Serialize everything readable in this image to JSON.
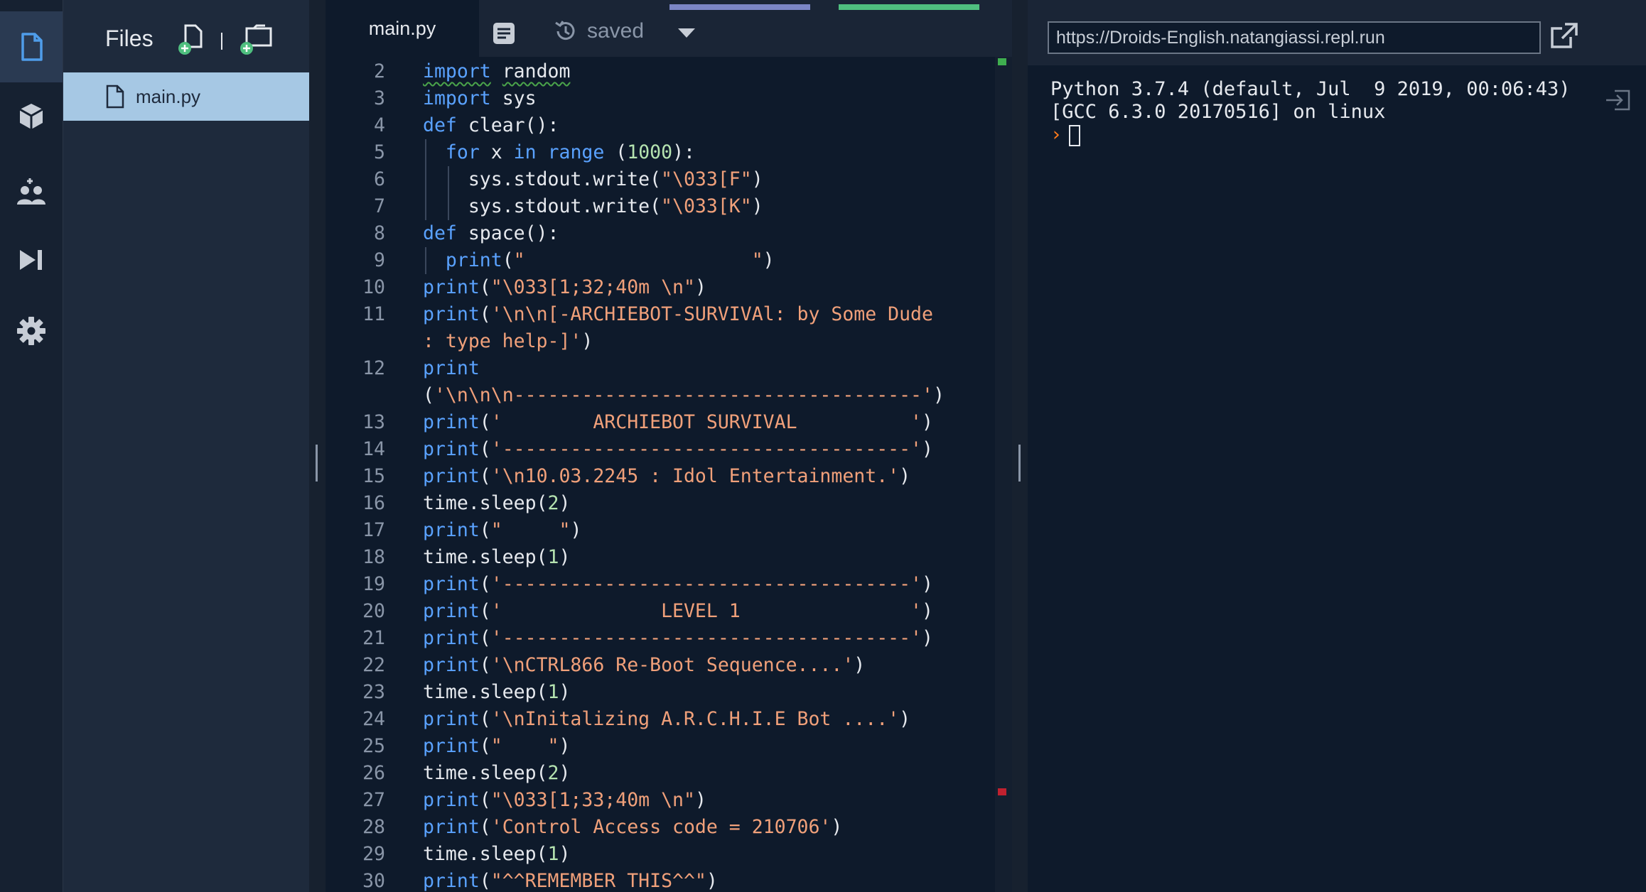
{
  "files_panel": {
    "title": "Files",
    "files": [
      {
        "name": "main.py",
        "selected": true
      }
    ]
  },
  "editor": {
    "tab_label": "main.py",
    "save_status": "saved"
  },
  "code_lines": [
    {
      "n": "2",
      "tokens": [
        [
          "kw sq",
          "import"
        ],
        [
          "",
          " "
        ],
        [
          "sq",
          "random"
        ]
      ]
    },
    {
      "n": "3",
      "tokens": [
        [
          "kw",
          "import"
        ],
        [
          "",
          " sys"
        ]
      ]
    },
    {
      "n": "4",
      "tokens": [
        [
          "kw",
          "def"
        ],
        [
          "",
          " clear():"
        ]
      ]
    },
    {
      "n": "5",
      "tokens": [
        [
          "",
          "  "
        ],
        [
          "kw",
          "for"
        ],
        [
          "",
          " x "
        ],
        [
          "kw",
          "in"
        ],
        [
          "",
          " "
        ],
        [
          "kw",
          "range"
        ],
        [
          "",
          " ("
        ],
        [
          "num",
          "1000"
        ],
        [
          "",
          "):"
        ]
      ]
    },
    {
      "n": "6",
      "tokens": [
        [
          "",
          "    sys.stdout.write("
        ],
        [
          "str",
          "\"\\033[F\""
        ],
        [
          "",
          ")"
        ]
      ]
    },
    {
      "n": "7",
      "tokens": [
        [
          "",
          "    sys.stdout.write("
        ],
        [
          "str",
          "\"\\033[K\""
        ],
        [
          "",
          ")"
        ]
      ]
    },
    {
      "n": "8",
      "tokens": [
        [
          "kw",
          "def"
        ],
        [
          "",
          " space():"
        ]
      ]
    },
    {
      "n": "9",
      "tokens": [
        [
          "",
          "  "
        ],
        [
          "kw",
          "print"
        ],
        [
          "",
          "("
        ],
        [
          "str",
          "\"                    \""
        ],
        [
          "",
          ")"
        ]
      ]
    },
    {
      "n": "10",
      "tokens": [
        [
          "kw",
          "print"
        ],
        [
          "",
          "("
        ],
        [
          "str",
          "\"\\033[1;32;40m \\n\""
        ],
        [
          "",
          ")"
        ]
      ]
    },
    {
      "n": "11",
      "tokens": [
        [
          "kw",
          "print"
        ],
        [
          "",
          "("
        ],
        [
          "str",
          "'\\n\\n[-ARCHIEBOT-SURVIVAl: by Some Dude"
        ]
      ]
    },
    {
      "n": "",
      "tokens": [
        [
          "str",
          ": type help-]'"
        ],
        [
          "",
          ")"
        ]
      ]
    },
    {
      "n": "12",
      "tokens": [
        [
          "kw",
          "print"
        ]
      ]
    },
    {
      "n": "",
      "tokens": [
        [
          "",
          "("
        ],
        [
          "str",
          "'\\n\\n\\n------------------------------------'"
        ],
        [
          "",
          ")"
        ]
      ]
    },
    {
      "n": "13",
      "tokens": [
        [
          "kw",
          "print"
        ],
        [
          "",
          "("
        ],
        [
          "str",
          "'        ARCHIEBOT SURVIVAL          '"
        ],
        [
          "",
          ")"
        ]
      ]
    },
    {
      "n": "14",
      "tokens": [
        [
          "kw",
          "print"
        ],
        [
          "",
          "("
        ],
        [
          "str",
          "'------------------------------------'"
        ],
        [
          "",
          ")"
        ]
      ]
    },
    {
      "n": "15",
      "tokens": [
        [
          "kw",
          "print"
        ],
        [
          "",
          "("
        ],
        [
          "str",
          "'\\n10.03.2245 : Idol Entertainment.'"
        ],
        [
          "",
          ")"
        ]
      ]
    },
    {
      "n": "16",
      "tokens": [
        [
          "",
          "time.sleep("
        ],
        [
          "num",
          "2"
        ],
        [
          "",
          ")"
        ]
      ]
    },
    {
      "n": "17",
      "tokens": [
        [
          "kw",
          "print"
        ],
        [
          "",
          "("
        ],
        [
          "str",
          "\"     \""
        ],
        [
          "",
          ")"
        ]
      ]
    },
    {
      "n": "18",
      "tokens": [
        [
          "",
          "time.sleep("
        ],
        [
          "num",
          "1"
        ],
        [
          "",
          ")"
        ]
      ]
    },
    {
      "n": "19",
      "tokens": [
        [
          "kw",
          "print"
        ],
        [
          "",
          "("
        ],
        [
          "str",
          "'------------------------------------'"
        ],
        [
          "",
          ")"
        ]
      ]
    },
    {
      "n": "20",
      "tokens": [
        [
          "kw",
          "print"
        ],
        [
          "",
          "("
        ],
        [
          "str",
          "'              LEVEL 1               '"
        ],
        [
          "",
          ")"
        ]
      ]
    },
    {
      "n": "21",
      "tokens": [
        [
          "kw",
          "print"
        ],
        [
          "",
          "("
        ],
        [
          "str",
          "'------------------------------------'"
        ],
        [
          "",
          ")"
        ]
      ]
    },
    {
      "n": "22",
      "tokens": [
        [
          "kw",
          "print"
        ],
        [
          "",
          "("
        ],
        [
          "str",
          "'\\nCTRL866 Re-Boot Sequence....'"
        ],
        [
          "",
          ")"
        ]
      ]
    },
    {
      "n": "23",
      "tokens": [
        [
          "",
          "time.sleep("
        ],
        [
          "num",
          "1"
        ],
        [
          "",
          ")"
        ]
      ]
    },
    {
      "n": "24",
      "tokens": [
        [
          "kw",
          "print"
        ],
        [
          "",
          "("
        ],
        [
          "str",
          "'\\nInitalizing A.R.C.H.I.E Bot ....'"
        ],
        [
          "",
          ")"
        ]
      ]
    },
    {
      "n": "25",
      "tokens": [
        [
          "kw",
          "print"
        ],
        [
          "",
          "("
        ],
        [
          "str",
          "\"    \""
        ],
        [
          "",
          ")"
        ]
      ]
    },
    {
      "n": "26",
      "tokens": [
        [
          "",
          "time.sleep("
        ],
        [
          "num",
          "2"
        ],
        [
          "",
          ")"
        ]
      ]
    },
    {
      "n": "27",
      "tokens": [
        [
          "kw",
          "print"
        ],
        [
          "",
          "("
        ],
        [
          "str",
          "\"\\033[1;33;40m \\n\""
        ],
        [
          "",
          ")"
        ]
      ]
    },
    {
      "n": "28",
      "tokens": [
        [
          "kw",
          "print"
        ],
        [
          "",
          "("
        ],
        [
          "str",
          "'Control Access code = 210706'"
        ],
        [
          "",
          ")"
        ]
      ]
    },
    {
      "n": "29",
      "tokens": [
        [
          "",
          "time.sleep("
        ],
        [
          "num",
          "1"
        ],
        [
          "",
          ")"
        ]
      ]
    },
    {
      "n": "30",
      "tokens": [
        [
          "kw",
          "print"
        ],
        [
          "",
          "("
        ],
        [
          "str",
          "\"^^REMEMBER THIS^^\""
        ],
        [
          "",
          ")"
        ]
      ]
    }
  ],
  "output": {
    "url": "https://Droids-English.natangiassi.repl.run",
    "console_line1": "Python 3.7.4 (default, Jul  9 2019, 00:06:43)",
    "console_line2": "[GCC 6.3.0 20170516] on linux",
    "prompt_symbol": "›"
  },
  "icons": {
    "activity": [
      "files-icon",
      "packages-icon",
      "multiplayer-icon",
      "debugger-icon",
      "settings-icon"
    ],
    "header": [
      "new-file-icon",
      "new-folder-icon",
      "notes-icon",
      "history-icon",
      "chevron-down-icon",
      "open-external-icon",
      "exit-icon"
    ]
  },
  "colors": {
    "keyword": "#5aa2ff",
    "string": "#f0a07a",
    "number": "#b5e3b0",
    "selected_file": "#a6c8e4",
    "tab_accent_purple": "#7b86c6",
    "tab_accent_green": "#4fbf7f",
    "prompt": "#ff7a1a"
  }
}
